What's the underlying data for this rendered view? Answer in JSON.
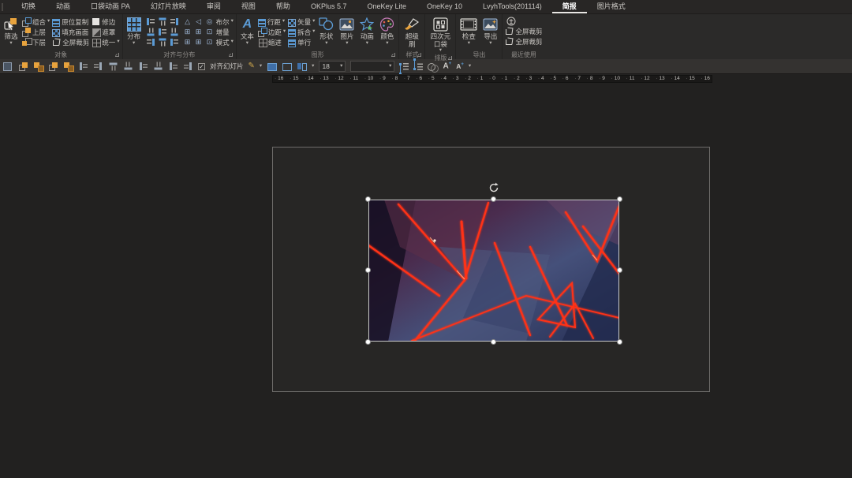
{
  "menu_tabs": [
    {
      "label": "切换",
      "active": false
    },
    {
      "label": "动画",
      "active": false
    },
    {
      "label": "口袋动画 PA",
      "active": false
    },
    {
      "label": "幻灯片放映",
      "active": false
    },
    {
      "label": "审阅",
      "active": false
    },
    {
      "label": "视图",
      "active": false
    },
    {
      "label": "帮助",
      "active": false
    },
    {
      "label": "OKPlus 5.7",
      "active": false
    },
    {
      "label": "OneKey Lite",
      "active": false
    },
    {
      "label": "OneKey 10",
      "active": false
    },
    {
      "label": "LvyhTools(201114)",
      "active": false
    },
    {
      "label": "简报",
      "active": true
    },
    {
      "label": "图片格式",
      "active": false
    }
  ],
  "ribbon": {
    "object_group": {
      "title": "对象",
      "filter_btn": "筛选",
      "col1": [
        "组合",
        "上层",
        "下层"
      ],
      "col2": [
        "原位复制",
        "填充画面",
        "全屏裁剪"
      ],
      "col3": [
        "修边",
        "遮罩",
        "统一"
      ]
    },
    "align_group": {
      "title": "对齐与分布",
      "distribute_btn": "分布",
      "bool_btn": "布尔",
      "increment_btn": "增量",
      "mode_btn": "模式"
    },
    "graphic_group": {
      "title": "图形",
      "text_btn": "文本",
      "col1": [
        "行距",
        "边距",
        "缩进"
      ],
      "col2": [
        "矢量",
        "拆合",
        "单行"
      ],
      "shape_btn": "形状",
      "picture_btn": "图片",
      "animation_btn": "动画",
      "color_btn": "颜色"
    },
    "style_group": {
      "title": "样式",
      "brush_btn": "超级刷"
    },
    "layout_group": {
      "title": "排版",
      "pocket_btn": "四次元口袋"
    },
    "export_group": {
      "title": "导出",
      "check_btn": "检查",
      "export_btn": "导出"
    },
    "recent_group": {
      "title": "最近使用",
      "items": [
        "全屏裁剪",
        "全屏裁剪"
      ]
    }
  },
  "toolbar": {
    "align_slides_label": "对齐幻灯片",
    "font_size_value": "18",
    "font_name_value": ""
  },
  "ruler_numbers": [
    16,
    15,
    14,
    13,
    12,
    11,
    10,
    9,
    8,
    7,
    6,
    5,
    4,
    3,
    2,
    1,
    0,
    1,
    2,
    3,
    4,
    5,
    6,
    7,
    8,
    9,
    10,
    11,
    12,
    13,
    14,
    15,
    16
  ],
  "slide": {
    "image_name": "abstract-red-shards-image",
    "accent_red": "#ff3118",
    "bg_navy": "#2c3458",
    "bg_purple": "#55304e"
  }
}
